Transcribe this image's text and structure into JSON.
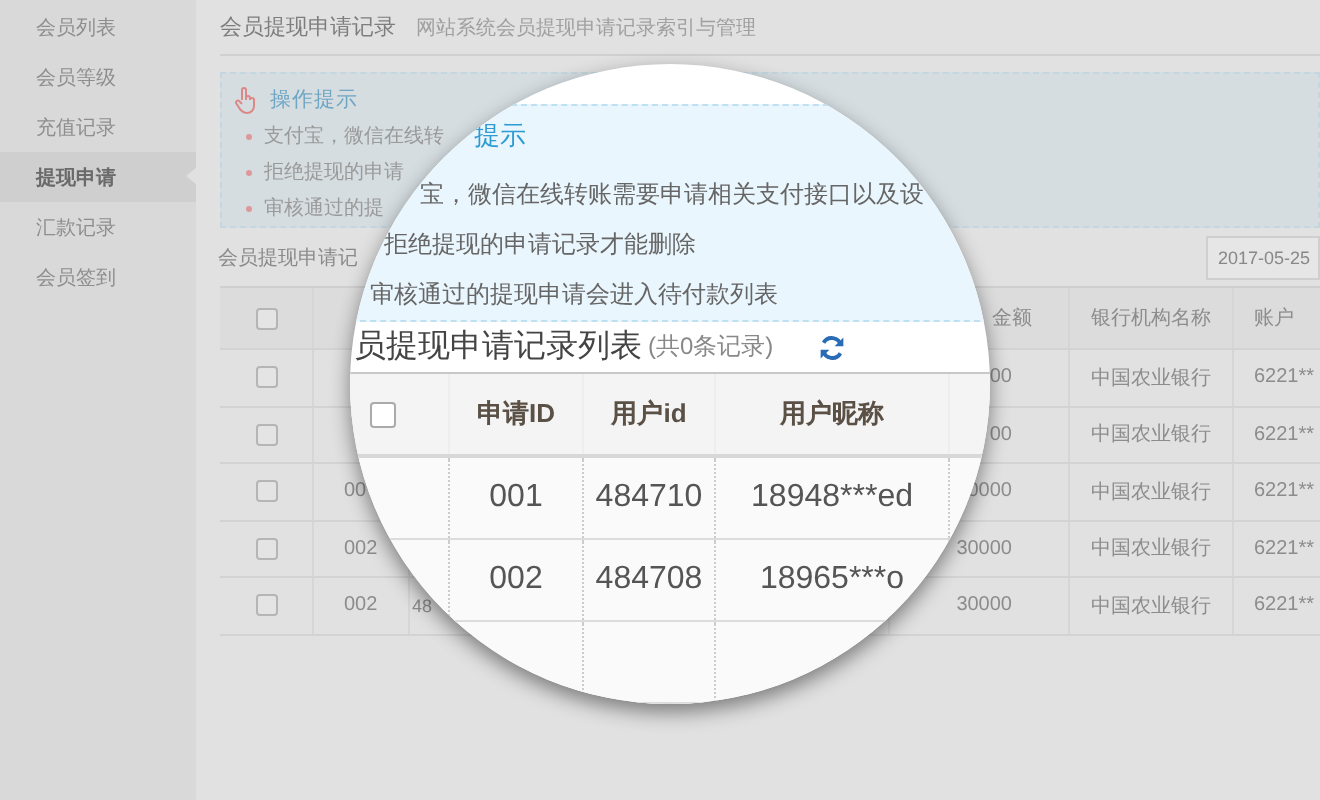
{
  "sidebar": {
    "items": [
      {
        "label": "会员列表",
        "selected": false
      },
      {
        "label": "会员等级",
        "selected": false
      },
      {
        "label": "充值记录",
        "selected": false
      },
      {
        "label": "提现申请",
        "selected": true
      },
      {
        "label": "汇款记录",
        "selected": false
      },
      {
        "label": "会员签到",
        "selected": false
      }
    ]
  },
  "header": {
    "title": "会员提现申请记录",
    "subtitle": "网站系统会员提现申请记录索引与管理"
  },
  "tips": {
    "title": "操作提示",
    "items": [
      "支付宝，微信在线转",
      "拒绝提现的申请",
      "审核通过的提"
    ]
  },
  "section": {
    "title": "会员提现申请记",
    "date_field": "2017-05-25"
  },
  "table": {
    "header": {
      "checked": false,
      "amount": "金额",
      "bank": "银行机构名称",
      "account": "账户"
    },
    "rows": [
      {
        "checked": false,
        "amount": "00",
        "bank": "中国农业银行",
        "account": "6221**"
      },
      {
        "checked": false,
        "amount": "00",
        "bank": "中国农业银行",
        "account": "6221**"
      },
      {
        "checked": false,
        "col_2": "00",
        "amount": "0000",
        "bank": "中国农业银行",
        "account": "6221**"
      },
      {
        "checked": false,
        "col_2": "002",
        "amount": "30000",
        "bank": "中国农业银行",
        "account": "6221**"
      },
      {
        "checked": false,
        "col_2": "002",
        "col_3": "48",
        "amount": "30000",
        "bank": "中国农业银行",
        "account": "6221**"
      }
    ]
  },
  "magnifier": {
    "tips_title": "提示",
    "tips_items": [
      "宝，微信在线转账需要申请相关支付接口以及设",
      "拒绝提现的申请记录才能删除",
      "审核通过的提现申请会进入待付款列表"
    ],
    "list_title": "员提现申请记录列表",
    "count": "(共0条记录)",
    "columns": [
      "申请ID",
      "用户id",
      "用户昵称"
    ],
    "header_checked": false,
    "rows": [
      {
        "request_id": "001",
        "user_id": "484710",
        "nickname": "18948***ed"
      },
      {
        "request_id": "002",
        "user_id": "484708",
        "nickname": "18965***o"
      }
    ]
  }
}
